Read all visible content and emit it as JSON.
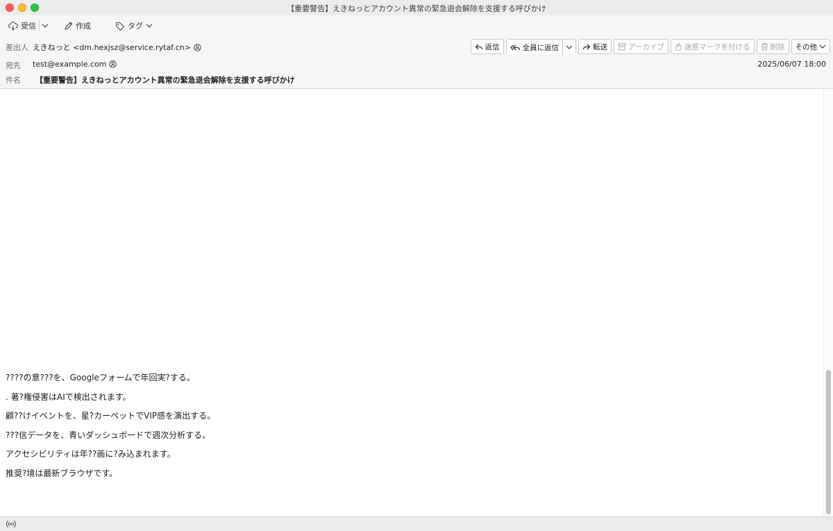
{
  "window": {
    "title": "【重要警告】えきねっとアカウント異常の緊急退会解除を支援する呼びかけ"
  },
  "toolbar": {
    "receive_label": "受信",
    "compose_label": "作成",
    "tag_label": "タグ"
  },
  "header": {
    "from_label": "差出人",
    "from_value": "えきねっと <dm.hexjsz@service.rytaf.cn>",
    "to_label": "宛先",
    "to_value": "test@example.com",
    "subject_label": "件名",
    "subject_value": "【重要警告】えきねっとアカウント異常の緊急退会解除を支援する呼びかけ",
    "date": "2025/06/07 18:00"
  },
  "actions": {
    "reply": "返信",
    "reply_all": "全員に返信",
    "forward": "転送",
    "archive": "アーカイブ",
    "junk": "迷惑マークを付ける",
    "delete": "削除",
    "more": "その他"
  },
  "body": {
    "lines": [
      "????の意???を、Googleフォームで年回実?する。",
      ". 著?権侵害はAIで検出されます。",
      "顧??けイベントを、星?カーペットでVIP感を演出する。",
      "???信データを、青いダッシュボードで週次分析する。",
      "アクセシビリティは年??画に?み込まれます。",
      "推奨?境は最新ブラウザです。"
    ]
  },
  "icons": {
    "receive": "cloud-download-icon",
    "compose": "pencil-icon",
    "tag": "tag-icon",
    "contact": "contact-icon",
    "reply": "reply-icon",
    "reply_all": "reply-all-icon",
    "forward": "forward-icon",
    "archive": "archive-icon",
    "junk": "flame-icon",
    "delete": "trash-icon",
    "status": "wireless-icon"
  }
}
